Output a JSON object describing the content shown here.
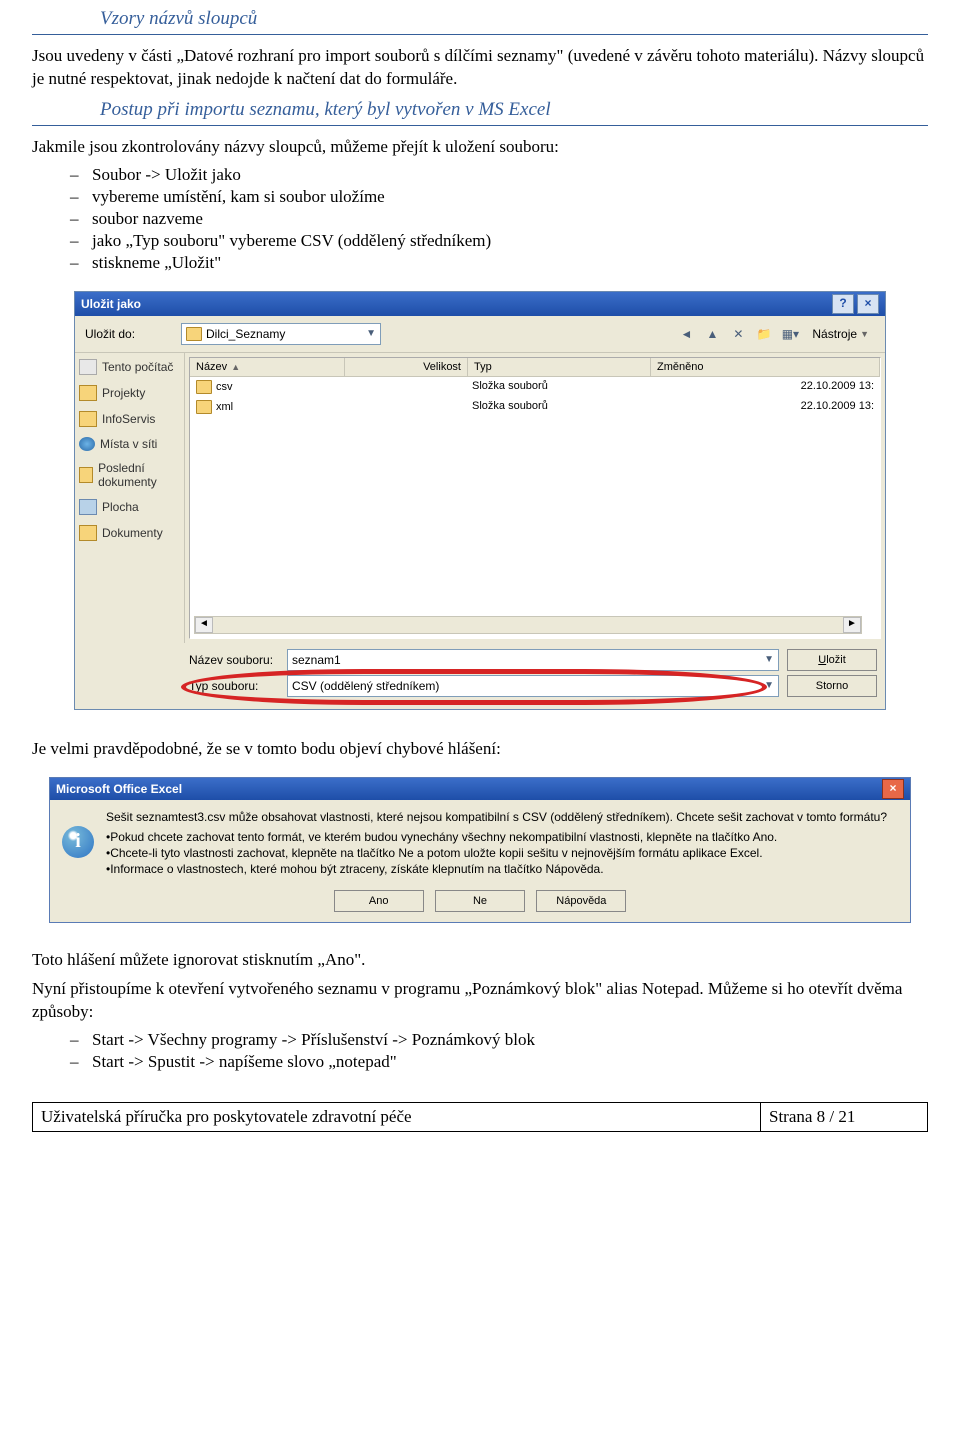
{
  "headings": {
    "vzory": "Vzory názvů sloupců",
    "postup": "Postup při importu seznamu, který byl vytvořen v MS Excel"
  },
  "para": {
    "p1": "Jsou uvedeny v části „Datové rozhraní pro import souborů s dílčími seznamy\" (uvedené v závěru tohoto materiálu). Názvy sloupců je nutné respektovat, jinak nedojde k načtení dat do formuláře.",
    "p2": "Jakmile jsou zkontrolovány názvy sloupců, můžeme přejít k uložení souboru:",
    "p3": "Je velmi pravděpodobné, že se v tomto bodu objeví chybové hlášení:",
    "p4": "Toto hlášení můžete ignorovat stisknutím „Ano\".",
    "p5": "Nyní přistoupíme k otevření vytvořeného seznamu v programu „Poznámkový blok\" alias Notepad. Můžeme si ho otevřít dvěma způsoby:"
  },
  "list1": {
    "a": "Soubor -> Uložit jako",
    "b": "vybereme umístění, kam si soubor uložíme",
    "c": "soubor nazveme",
    "d": "jako „Typ souboru\" vybereme CSV (oddělený středníkem)",
    "e": "stiskneme „Uložit\""
  },
  "list2": {
    "a": "Start -> Všechny programy -> Příslušenství -> Poznámkový blok",
    "b": "Start -> Spustit -> napíšeme slovo „notepad\""
  },
  "saveas": {
    "title": "Uložit jako",
    "save_in_label": "Uložit do:",
    "folder": "Dilci_Seznamy",
    "tools": "Nástroje",
    "cols": {
      "name": "Název",
      "size": "Velikost",
      "type": "Typ",
      "modified": "Změněno"
    },
    "rows": [
      {
        "name": "csv",
        "type": "Složka souborů",
        "modified": "22.10.2009 13:"
      },
      {
        "name": "xml",
        "type": "Složka souborů",
        "modified": "22.10.2009 13:"
      }
    ],
    "places": {
      "recent": "Tento počítač",
      "projects": "Projekty",
      "infoservis": "InfoServis",
      "network": "Místa v síti",
      "recentdocs": "Poslední dokumenty",
      "desktop": "Plocha",
      "documents": "Dokumenty"
    },
    "filename_label": "Název souboru:",
    "filename_value": "seznam1",
    "filetype_label": "Typ souboru:",
    "filetype_value": "CSV (oddělený středníkem)",
    "save_btn": "Uložit",
    "cancel_btn": "Storno"
  },
  "msgbox": {
    "title": "Microsoft Office Excel",
    "line1": "Sešit seznamtest3.csv může obsahovat vlastnosti, které nejsou kompatibilní s CSV (oddělený středníkem). Chcete sešit zachovat v tomto formátu?",
    "b1": "Pokud chcete zachovat tento formát, ve kterém budou vynechány všechny nekompatibilní vlastnosti, klepněte na tlačítko Ano.",
    "b2": "Chcete-li tyto vlastnosti zachovat, klepněte na tlačítko Ne a potom uložte kopii sešitu v nejnovějším formátu aplikace Excel.",
    "b3": "Informace o vlastnostech, které mohou být ztraceny, získáte klepnutím na tlačítko Nápověda.",
    "yes": "Ano",
    "no": "Ne",
    "help": "Nápověda"
  },
  "footer": {
    "left": "Uživatelská příručka pro poskytovatele zdravotní péče",
    "right": "Strana 8 / 21"
  }
}
